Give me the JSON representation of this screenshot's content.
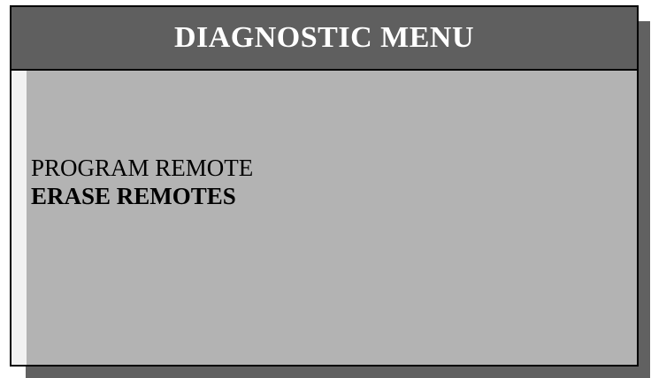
{
  "screen": {
    "title": "DIAGNOSTIC MENU",
    "colors": {
      "title_bar": "#5f5f5f",
      "title_text": "#ffffff",
      "body": "#b3b3b3",
      "shadow": "#616161"
    }
  },
  "menu": {
    "selected_index": 1,
    "items": [
      {
        "label": "PROGRAM REMOTE"
      },
      {
        "label": "ERASE REMOTES"
      }
    ]
  }
}
